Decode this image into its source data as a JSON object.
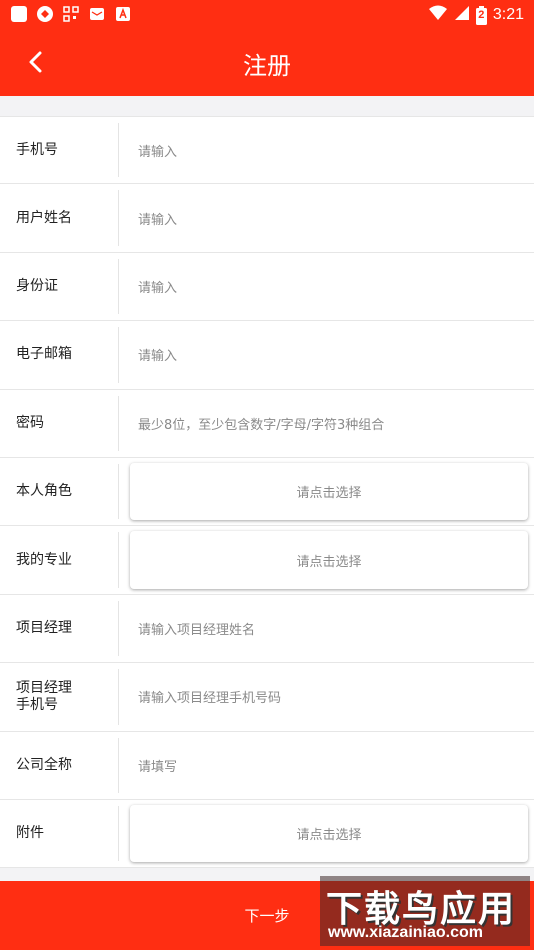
{
  "status_bar": {
    "time": "3:21",
    "battery_digit": "2"
  },
  "header": {
    "title": "注册"
  },
  "form": {
    "rows": [
      {
        "label": "手机号",
        "placeholder": "请输入"
      },
      {
        "label": "用户姓名",
        "placeholder": "请输入"
      },
      {
        "label": "身份证",
        "placeholder": "请输入"
      },
      {
        "label": "电子邮箱",
        "placeholder": "请输入"
      },
      {
        "label": "密码",
        "placeholder": "最少8位，至少包含数字/字母/字符3种组合"
      },
      {
        "label": "本人角色",
        "select": "请点击选择"
      },
      {
        "label": "我的专业",
        "select": "请点击选择"
      },
      {
        "label": "项目经理",
        "placeholder": "请输入项目经理姓名"
      },
      {
        "label": "项目经理\n手机号",
        "label_line1": "项目经理",
        "label_line2": "手机号",
        "placeholder": "请输入项目经理手机号码"
      },
      {
        "label": "公司全称",
        "placeholder": "请填写"
      },
      {
        "label": "附件",
        "select": "请点击选择"
      }
    ]
  },
  "footer": {
    "next_label": "下一步"
  },
  "watermark": {
    "title": "下载鸟应用",
    "url": "www.xiazainiao.com"
  },
  "colors": {
    "primary": "#ff2e12",
    "background": "#f3f3f5"
  }
}
